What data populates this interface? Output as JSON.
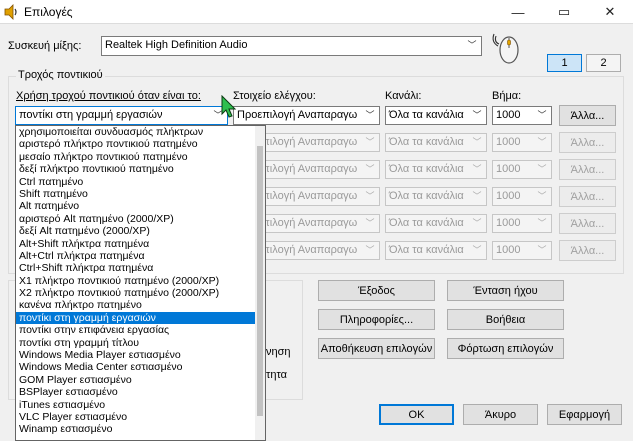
{
  "window": {
    "title": "Επιλογές",
    "minimize": "—",
    "restore": "▭",
    "close": "✕"
  },
  "device": {
    "label": "Συσκευή μίξης:",
    "value": "Realtek High Definition Audio"
  },
  "pages": [
    "1",
    "2"
  ],
  "group_title": "Τροχός ποντικιού",
  "headers": {
    "usage": "Χρήση τροχού ποντικιού όταν είναι το:",
    "control": "Στοιχείο ελέγχου:",
    "channel": "Κανάλι:",
    "step": "Βήμα:"
  },
  "usage_selected": "ποντίκι στη γραμμή εργασιών",
  "rows": [
    {
      "control": "Προεπιλογή Αναπαραγω",
      "channel": "Όλα τα κανάλια",
      "step": "1000",
      "button": "Άλλα..."
    },
    {
      "control": "Προεπιλογή Αναπαραγω",
      "channel": "Όλα τα κανάλια",
      "step": "1000",
      "button": "Άλλα..."
    },
    {
      "control": "Προεπιλογή Αναπαραγω",
      "channel": "Όλα τα κανάλια",
      "step": "1000",
      "button": "Άλλα..."
    },
    {
      "control": "Προεπιλογή Αναπαραγω",
      "channel": "Όλα τα κανάλια",
      "step": "1000",
      "button": "Άλλα..."
    },
    {
      "control": "Προεπιλογή Αναπαραγω",
      "channel": "Όλα τα κανάλια",
      "step": "1000",
      "button": "Άλλα..."
    },
    {
      "control": "Προεπιλογή Αναπαραγω",
      "channel": "Όλα τα κανάλια",
      "step": "1000",
      "button": "Άλλα..."
    }
  ],
  "dropdown_items": [
    "χρησιμοποιείται συνδυασμός πλήκτρων",
    "αριστερό πλήκτρο ποντικιού πατημένο",
    "μεσαίο πλήκτρο ποντικιού πατημένο",
    "δεξί πλήκτρο ποντικιού πατημένο",
    "Ctrl πατημένο",
    "Shift πατημένο",
    "Alt πατημένο",
    "αριστερό Alt πατημένο (2000/XP)",
    "δεξί Alt πατημένο (2000/XP)",
    "Alt+Shift πλήκτρα πατημένα",
    "Alt+Ctrl πλήκτρα πατημένα",
    "Ctrl+Shift πλήκτρα πατημένα",
    "X1 πλήκτρο ποντικιού πατημένο (2000/XP)",
    "X2 πλήκτρο ποντικιού πατημένο (2000/XP)",
    "κανένα πλήκτρο πατημένο",
    "ποντίκι στη γραμμή εργασιών",
    "ποντίκι στην επιφάνεια εργασίας",
    "ποντίκι στη γραμμή τίτλου",
    "Windows Media Player εστιασμένο",
    "Windows Media Center εστιασμένο",
    "GOM Player εστιασμένο",
    "BSPlayer εστιασμένο",
    "iTunes εστιασμένο",
    "VLC Player εστιασμένο",
    "Winamp εστιασμένο"
  ],
  "selected_index": 15,
  "partial_labels": [
    "νηση",
    "τητα"
  ],
  "buttons": {
    "exit": "Έξοδος",
    "sound_volume": "Ένταση ήχου",
    "info": "Πληροφορίες...",
    "help": "Βοήθεια",
    "save_options": "Αποθήκευση επιλογών",
    "load_options": "Φόρτωση επιλογών",
    "ok": "ΟΚ",
    "cancel": "Άκυρο",
    "apply": "Εφαρμογή"
  },
  "colors": {
    "accent": "#0078d7",
    "selection": "#0078d7"
  }
}
